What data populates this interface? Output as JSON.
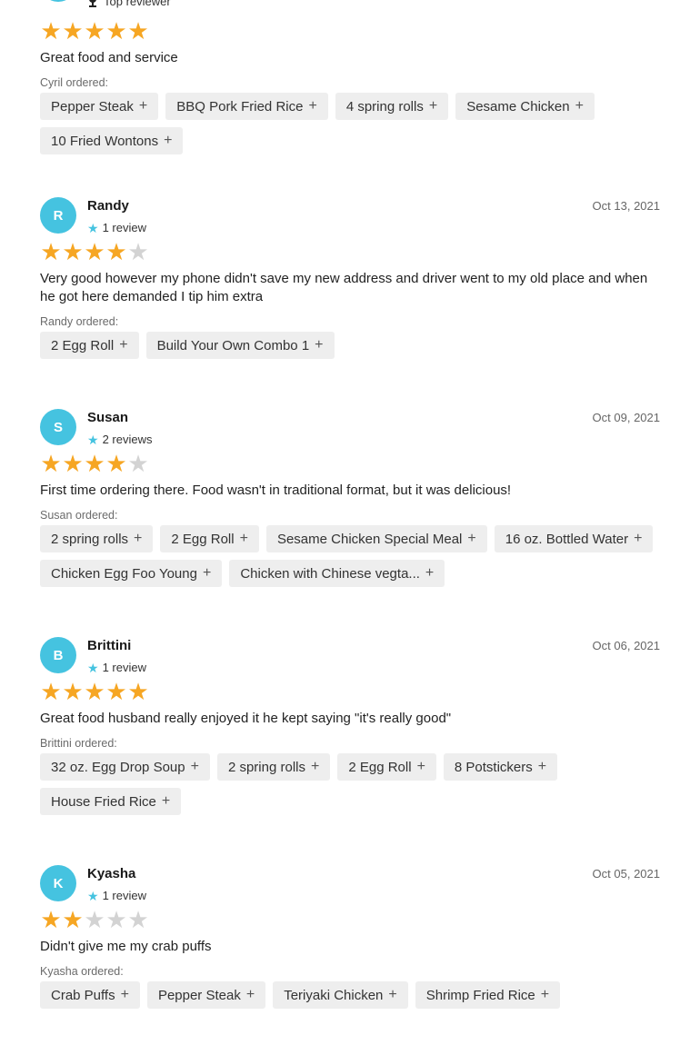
{
  "colors": {
    "avatar": "#45c3e0",
    "star_on": "#f6a623",
    "star_off": "#d3d3d3",
    "chip_bg": "#eeeeee"
  },
  "icons": {
    "plus": "+",
    "star": "★",
    "trophy": "trophy-icon"
  },
  "top": {
    "badge": "Top reviewer",
    "rating": 5,
    "text": "Great food and service",
    "ordered_label": "Cyril ordered:",
    "items": [
      "Pepper Steak",
      "BBQ Pork Fried Rice",
      "4 spring rolls",
      "Sesame Chicken",
      "10 Fried Wontons"
    ]
  },
  "reviews": [
    {
      "initial": "R",
      "name": "Randy",
      "count": "1 review",
      "date": "Oct 13, 2021",
      "rating": 4,
      "text": "Very good however my phone didn't save my new address and driver went to my old place and when he got here demanded I tip him extra",
      "ordered_label": "Randy ordered:",
      "items": [
        "2 Egg Roll",
        "Build Your Own Combo 1"
      ]
    },
    {
      "initial": "S",
      "name": "Susan",
      "count": "2 reviews",
      "date": "Oct 09, 2021",
      "rating": 4,
      "text": "First time ordering there. Food wasn't in traditional format, but it was delicious!",
      "ordered_label": "Susan ordered:",
      "items": [
        "2 spring rolls",
        "2 Egg Roll",
        "Sesame Chicken Special Meal",
        "16 oz. Bottled Water",
        "Chicken Egg Foo Young",
        "Chicken with Chinese vegta..."
      ]
    },
    {
      "initial": "B",
      "name": "Brittini",
      "count": "1 review",
      "date": "Oct 06, 2021",
      "rating": 5,
      "text": "Great food husband really enjoyed it he kept saying \"it's really good\"",
      "ordered_label": "Brittini ordered:",
      "items": [
        "32 oz. Egg Drop Soup",
        "2 spring rolls",
        "2 Egg Roll",
        "8 Potstickers",
        "House Fried Rice"
      ]
    },
    {
      "initial": "K",
      "name": "Kyasha",
      "count": "1 review",
      "date": "Oct 05, 2021",
      "rating": 2,
      "text": "Didn't give me my crab puffs",
      "ordered_label": "Kyasha ordered:",
      "items": [
        "Crab Puffs",
        "Pepper Steak",
        "Teriyaki Chicken",
        "Shrimp Fried Rice"
      ]
    }
  ]
}
